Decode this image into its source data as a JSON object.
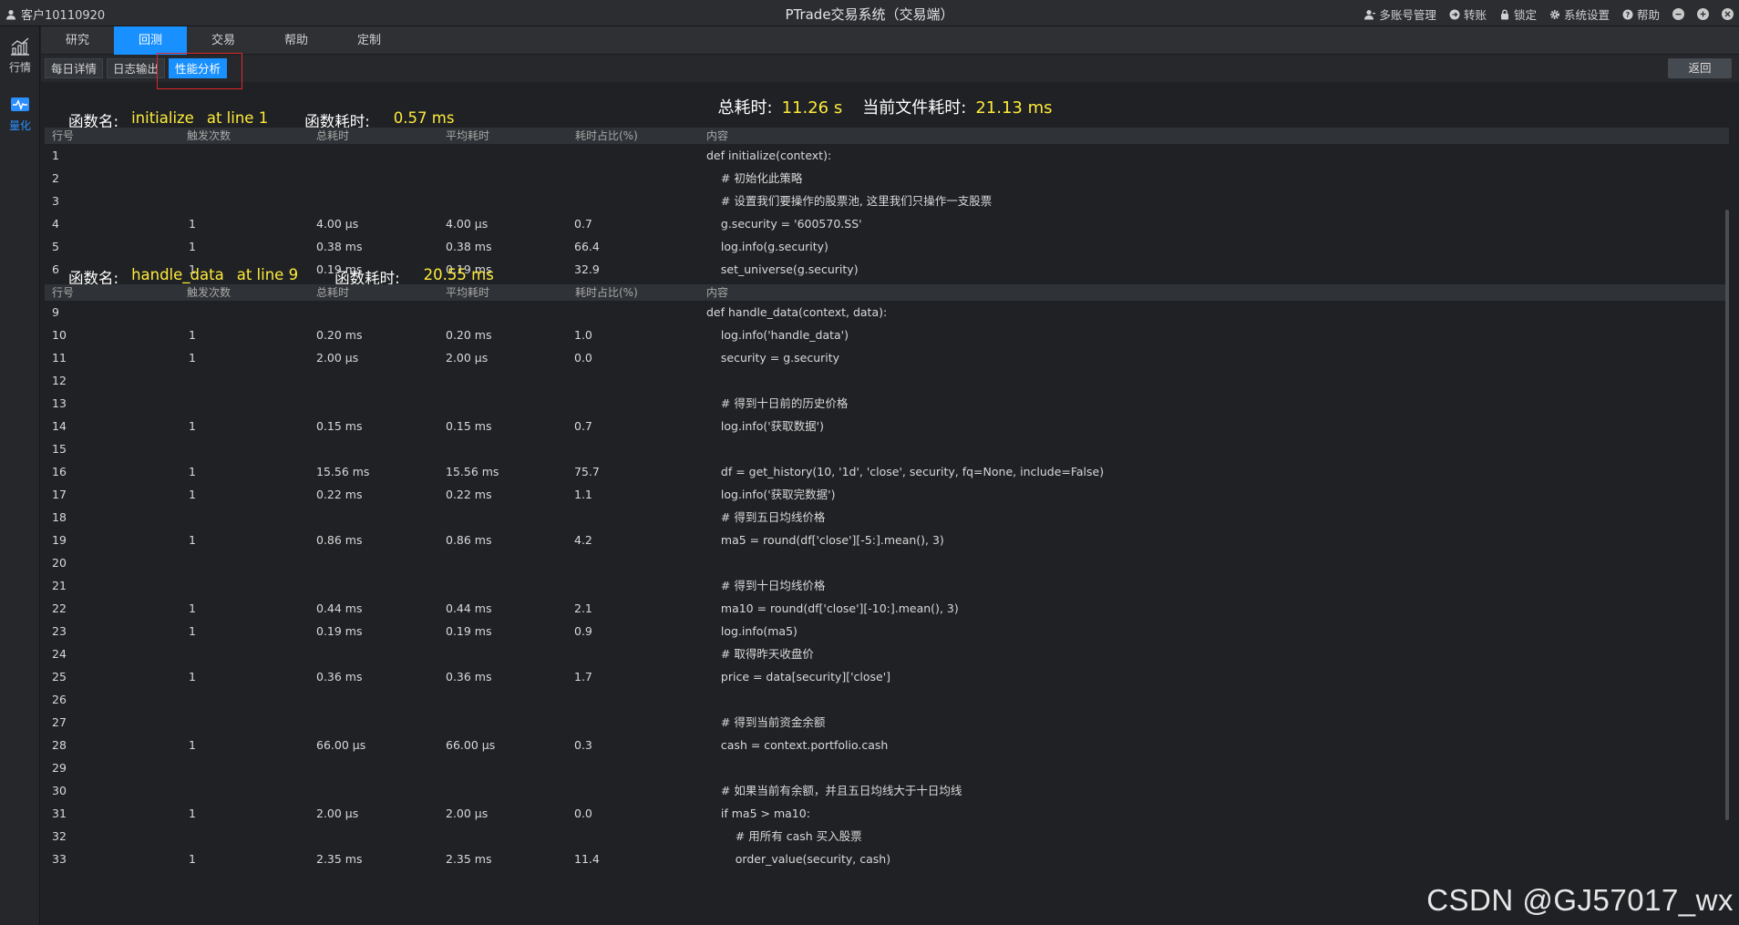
{
  "titlebar": {
    "client": "客户10110920",
    "title": "PTrade交易系统（交易端）",
    "menu": [
      {
        "label": "多账号管理",
        "icon": "user-icon"
      },
      {
        "label": "转账",
        "icon": "transfer-icon"
      },
      {
        "label": "锁定",
        "icon": "lock-icon"
      },
      {
        "label": "系统设置",
        "icon": "gear-icon"
      },
      {
        "label": "帮助",
        "icon": "help-icon"
      }
    ]
  },
  "sidebar": {
    "items": [
      {
        "label": "行情",
        "icon": "chart-icon",
        "active": false
      },
      {
        "label": "量化",
        "icon": "quant-icon",
        "active": true
      }
    ]
  },
  "tabs": [
    {
      "label": "研究",
      "active": false
    },
    {
      "label": "回测",
      "active": true
    },
    {
      "label": "交易",
      "active": false
    },
    {
      "label": "帮助",
      "active": false
    },
    {
      "label": "定制",
      "active": false
    }
  ],
  "subtabs": [
    {
      "label": "每日详情",
      "active": false
    },
    {
      "label": "日志输出",
      "active": false
    },
    {
      "label": "性能分析",
      "active": true
    }
  ],
  "back_label": "返回",
  "summary": {
    "total_label": "总耗时:",
    "total_value": "11.26 s",
    "file_label": "当前文件耗时:",
    "file_value": "21.13 ms"
  },
  "columns": [
    "行号",
    "触发次数",
    "总耗时",
    "平均耗时",
    "耗时占比(%)",
    "内容"
  ],
  "functions": [
    {
      "name_label": "函数名:",
      "name": "initialize",
      "line": "at line 1",
      "time_label": "函数耗时:",
      "time": "0.57 ms",
      "rows": [
        {
          "line": "1",
          "hits": "",
          "total": "",
          "avg": "",
          "pct": "",
          "code": "def initialize(context):"
        },
        {
          "line": "2",
          "hits": "",
          "total": "",
          "avg": "",
          "pct": "",
          "code": "    # 初始化此策略"
        },
        {
          "line": "3",
          "hits": "",
          "total": "",
          "avg": "",
          "pct": "",
          "code": "    # 设置我们要操作的股票池, 这里我们只操作一支股票"
        },
        {
          "line": "4",
          "hits": "1",
          "total": "4.00 μs",
          "avg": "4.00 μs",
          "pct": "0.7",
          "code": "    g.security = '600570.SS'"
        },
        {
          "line": "5",
          "hits": "1",
          "total": "0.38 ms",
          "avg": "0.38 ms",
          "pct": "66.4",
          "code": "    log.info(g.security)"
        },
        {
          "line": "6",
          "hits": "1",
          "total": "0.19 ms",
          "avg": "0.19 ms",
          "pct": "32.9",
          "code": "    set_universe(g.security)"
        }
      ]
    },
    {
      "name_label": "函数名:",
      "name": "handle_data",
      "line": "at line 9",
      "time_label": "函数耗时:",
      "time": "20.55 ms",
      "rows": [
        {
          "line": "9",
          "hits": "",
          "total": "",
          "avg": "",
          "pct": "",
          "code": "def handle_data(context, data):"
        },
        {
          "line": "10",
          "hits": "1",
          "total": "0.20 ms",
          "avg": "0.20 ms",
          "pct": "1.0",
          "code": "    log.info('handle_data')"
        },
        {
          "line": "11",
          "hits": "1",
          "total": "2.00 μs",
          "avg": "2.00 μs",
          "pct": "0.0",
          "code": "    security = g.security"
        },
        {
          "line": "12",
          "hits": "",
          "total": "",
          "avg": "",
          "pct": "",
          "code": ""
        },
        {
          "line": "13",
          "hits": "",
          "total": "",
          "avg": "",
          "pct": "",
          "code": "    # 得到十日前的历史价格"
        },
        {
          "line": "14",
          "hits": "1",
          "total": "0.15 ms",
          "avg": "0.15 ms",
          "pct": "0.7",
          "code": "    log.info('获取数据')"
        },
        {
          "line": "15",
          "hits": "",
          "total": "",
          "avg": "",
          "pct": "",
          "code": ""
        },
        {
          "line": "16",
          "hits": "1",
          "total": "15.56 ms",
          "avg": "15.56 ms",
          "pct": "75.7",
          "code": "    df = get_history(10, '1d', 'close', security, fq=None, include=False)"
        },
        {
          "line": "17",
          "hits": "1",
          "total": "0.22 ms",
          "avg": "0.22 ms",
          "pct": "1.1",
          "code": "    log.info('获取完数据')"
        },
        {
          "line": "18",
          "hits": "",
          "total": "",
          "avg": "",
          "pct": "",
          "code": "    # 得到五日均线价格"
        },
        {
          "line": "19",
          "hits": "1",
          "total": "0.86 ms",
          "avg": "0.86 ms",
          "pct": "4.2",
          "code": "    ma5 = round(df['close'][-5:].mean(), 3)"
        },
        {
          "line": "20",
          "hits": "",
          "total": "",
          "avg": "",
          "pct": "",
          "code": ""
        },
        {
          "line": "21",
          "hits": "",
          "total": "",
          "avg": "",
          "pct": "",
          "code": "    # 得到十日均线价格"
        },
        {
          "line": "22",
          "hits": "1",
          "total": "0.44 ms",
          "avg": "0.44 ms",
          "pct": "2.1",
          "code": "    ma10 = round(df['close'][-10:].mean(), 3)"
        },
        {
          "line": "23",
          "hits": "1",
          "total": "0.19 ms",
          "avg": "0.19 ms",
          "pct": "0.9",
          "code": "    log.info(ma5)"
        },
        {
          "line": "24",
          "hits": "",
          "total": "",
          "avg": "",
          "pct": "",
          "code": "    # 取得昨天收盘价"
        },
        {
          "line": "25",
          "hits": "1",
          "total": "0.36 ms",
          "avg": "0.36 ms",
          "pct": "1.7",
          "code": "    price = data[security]['close']"
        },
        {
          "line": "26",
          "hits": "",
          "total": "",
          "avg": "",
          "pct": "",
          "code": ""
        },
        {
          "line": "27",
          "hits": "",
          "total": "",
          "avg": "",
          "pct": "",
          "code": "    # 得到当前资金余额"
        },
        {
          "line": "28",
          "hits": "1",
          "total": "66.00 μs",
          "avg": "66.00 μs",
          "pct": "0.3",
          "code": "    cash = context.portfolio.cash"
        },
        {
          "line": "29",
          "hits": "",
          "total": "",
          "avg": "",
          "pct": "",
          "code": ""
        },
        {
          "line": "30",
          "hits": "",
          "total": "",
          "avg": "",
          "pct": "",
          "code": "    # 如果当前有余额，并且五日均线大于十日均线"
        },
        {
          "line": "31",
          "hits": "1",
          "total": "2.00 μs",
          "avg": "2.00 μs",
          "pct": "0.0",
          "code": "    if ma5 > ma10:"
        },
        {
          "line": "32",
          "hits": "",
          "total": "",
          "avg": "",
          "pct": "",
          "code": "        # 用所有 cash 买入股票"
        },
        {
          "line": "33",
          "hits": "1",
          "total": "2.35 ms",
          "avg": "2.35 ms",
          "pct": "11.4",
          "code": "        order_value(security, cash)"
        }
      ]
    }
  ],
  "watermark": "CSDN @GJ57017_wx"
}
